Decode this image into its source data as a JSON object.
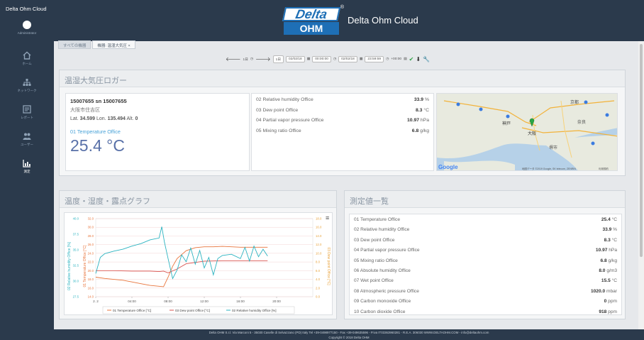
{
  "app": {
    "brand": "Delta Ohm Cloud",
    "title": "Delta Ohm Cloud",
    "logo_top": "Delta",
    "logo_bottom": "OHM",
    "logo_reg": "®"
  },
  "sidebar": {
    "user_name": "Administrator",
    "items": [
      {
        "label": "ホーム",
        "icon": "home-icon"
      },
      {
        "label": "ネットワーク",
        "icon": "network-icon"
      },
      {
        "label": "レポート",
        "icon": "report-icon"
      },
      {
        "label": "ユーザー",
        "icon": "users-icon"
      },
      {
        "label": "測定",
        "icon": "chart-icon"
      }
    ]
  },
  "tabs": [
    {
      "label": "すべての機器"
    },
    {
      "label": "機器: 温湿大気圧"
    }
  ],
  "toolbar": {
    "step": "1日",
    "range": "1日",
    "date_from": "02/02/18",
    "time_from": "00:00:00",
    "date_to": "02/02/18",
    "time_to": "23:59:59",
    "timezone": "+00:00"
  },
  "panel_logger": {
    "title": "温湿大気圧ロガー",
    "device_line": "15007655 sn 15007655",
    "address": "大阪市住吉区",
    "lat_label": "Lat.",
    "lat": "34.599",
    "lon_label": "Lon.",
    "lon": "135.494",
    "alt_label": "Alt.",
    "alt": "0",
    "main_label": "01 Temperature Office",
    "main_value": "25.4 °C",
    "measurements": [
      {
        "name": "02 Relative humidity Office",
        "value": "33.9",
        "unit": "%"
      },
      {
        "name": "03 Dew point Office",
        "value": "8.3",
        "unit": "°C"
      },
      {
        "name": "04 Partial vapor pressure Office",
        "value": "10.97",
        "unit": "hPa"
      },
      {
        "name": "05 Mixing ratio Office",
        "value": "6.8",
        "unit": "g/kg"
      }
    ],
    "map_labels": [
      "神戸",
      "大阪",
      "奈良",
      "京都",
      "堺市",
      "Google",
      "地図データ ©2019 Google, SK telecom, ZENRIN",
      "利用規約"
    ]
  },
  "panel_chart": {
    "title": "温度・湿度・露点グラフ",
    "menu_glyph": "≡",
    "y_left_outer_label": "02 Relative humidity Office [%]",
    "y_left_inner_label": "01 Temperature Office [°C]",
    "y_right_label": "03 Dew point Office [°C]",
    "legend": [
      "01 Temperature Office [°C]",
      "03 Dew point Office [°C]",
      "02 Relative humidity Office [%]"
    ]
  },
  "chart_data": {
    "type": "line",
    "x_ticks": [
      "2. 2",
      "04:00",
      "08:00",
      "12:00",
      "16:00",
      "20:00"
    ],
    "x_range_hours": [
      0,
      24
    ],
    "y_humidity_ticks": [
      "40.0",
      "37.5",
      "35.0",
      "32.5",
      "30.0",
      "27.5"
    ],
    "y_humidity_range": [
      27.5,
      40.0
    ],
    "y_temp_ticks": [
      "32.0",
      "30.0",
      "28.0",
      "26.0",
      "24.0",
      "22.0",
      "20.0",
      "18.0",
      "16.0",
      "14.0"
    ],
    "y_temp_range": [
      14.0,
      32.0
    ],
    "y_dew_ticks": [
      "18.0",
      "16.0",
      "14.0",
      "12.0",
      "10.0",
      "8.0",
      "6.0",
      "4.0",
      "2.0",
      "0.0"
    ],
    "y_dew_range": [
      0.0,
      18.0
    ],
    "series": [
      {
        "name": "01 Temperature Office [°C]",
        "color": "#e8743b",
        "axis": "temp",
        "x": [
          0,
          1,
          2,
          3,
          4,
          5,
          6,
          7,
          7.5,
          8,
          8.5,
          9,
          10,
          11,
          12,
          13,
          14,
          15,
          16,
          17,
          18,
          19
        ],
        "y": [
          18.5,
          18.2,
          18.0,
          17.8,
          17.4,
          17.0,
          16.6,
          16.4,
          16.3,
          18.5,
          21.0,
          22.8,
          24.6,
          25.3,
          25.5,
          25.5,
          25.6,
          25.5,
          25.4,
          25.4,
          25.4,
          25.4
        ]
      },
      {
        "name": "03 Dew point Office [°C]",
        "color": "#d9534f",
        "axis": "dew",
        "x": [
          0,
          2,
          4,
          6,
          7,
          7.5,
          8,
          9,
          10,
          12,
          14,
          16,
          18,
          19
        ],
        "y": [
          6.0,
          6.0,
          5.9,
          5.9,
          5.8,
          5.9,
          5.5,
          6.4,
          7.6,
          8.2,
          8.3,
          8.3,
          8.3,
          8.3
        ]
      },
      {
        "name": "02 Relative humidity Office [%]",
        "color": "#2bb3c0",
        "axis": "humidity",
        "x": [
          0,
          0.5,
          1,
          2,
          3,
          4,
          5,
          6,
          7,
          7.3,
          7.6,
          8,
          8.5,
          9,
          9.5,
          10,
          10.5,
          11,
          11.5,
          12,
          12.5,
          13,
          13.5,
          14,
          15,
          16,
          16.5,
          17,
          17.5,
          18,
          18.5,
          19
        ],
        "y": [
          31.2,
          33.8,
          34.4,
          34.8,
          35.1,
          35.6,
          36.0,
          36.6,
          36.9,
          38.7,
          36.2,
          33.6,
          30.4,
          31.8,
          34.2,
          33.1,
          35.3,
          32.7,
          34.9,
          32.1,
          33.8,
          31.0,
          33.6,
          34.1,
          34.3,
          33.6,
          35.4,
          33.2,
          35.6,
          33.9,
          35.1,
          34.0
        ]
      }
    ]
  },
  "panel_list": {
    "title": "測定値一覧",
    "rows": [
      {
        "name": "01 Temperature Office",
        "value": "25.4",
        "unit": "°C"
      },
      {
        "name": "02 Relative humidity Office",
        "value": "33.9",
        "unit": "%"
      },
      {
        "name": "03 Dew point Office",
        "value": "8.3",
        "unit": "°C"
      },
      {
        "name": "04 Partial vapor pressure Office",
        "value": "10.97",
        "unit": "hPa"
      },
      {
        "name": "05 Mixing ratio Office",
        "value": "6.8",
        "unit": "g/kg"
      },
      {
        "name": "06 Absolute humidity Office",
        "value": "8.0",
        "unit": "g/m3"
      },
      {
        "name": "07 Wet point Office",
        "value": "15.5",
        "unit": "°C"
      },
      {
        "name": "08 Atmospheric pressure Office",
        "value": "1020.0",
        "unit": "mbar"
      },
      {
        "name": "09 Carbon monoxide Office",
        "value": "0",
        "unit": "ppm"
      },
      {
        "name": "10 Carbon dioxide Office",
        "value": "918",
        "unit": "ppm"
      }
    ]
  },
  "footer": {
    "line1": "Delta OHM S.r.l. Via Marconi 5 - 35030 Caselle di Selvazzano (PD) Italy Tel +39-0498977150 - Fax +39-049635596 - P.iva IT03363960281 - R.E.A. 306030 WWW.DELTAOHM.COM - info@deltaohm.com",
    "line2": "Copyright © 2018 Delta OHM"
  },
  "colors": {
    "nav_bg": "#2b3a4c",
    "accent": "#1e6fb6",
    "big_value": "#5870a8"
  }
}
